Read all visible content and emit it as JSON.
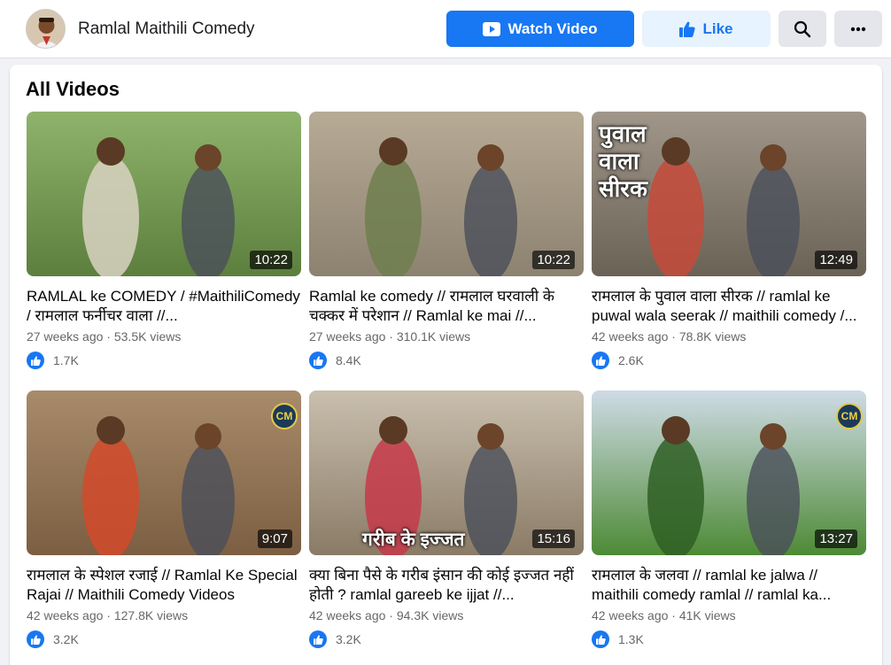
{
  "header": {
    "page_name": "Ramlal Maithili Comedy",
    "watch_label": "Watch Video",
    "like_label": "Like"
  },
  "section_title": "All Videos",
  "videos": [
    {
      "title": "RAMLAL ke COMEDY / #MaithiliComedy / रामलाल फर्नीचर वाला //...",
      "age": "27 weeks ago",
      "views": "53.5K views",
      "likes": "1.7K",
      "duration": "10:22",
      "overlay": "",
      "caption": "",
      "badge": "",
      "colors": [
        "#8fb36b",
        "#5c7f3e",
        "#d9d2c2"
      ]
    },
    {
      "title": "Ramlal ke comedy // रामलाल घरवाली के चक्कर में परेशान // Ramlal ke mai //...",
      "age": "27 weeks ago",
      "views": "310.1K views",
      "likes": "8.4K",
      "duration": "10:22",
      "overlay": "",
      "caption": "",
      "badge": "",
      "colors": [
        "#b7ab96",
        "#8d8270",
        "#6e7f4e"
      ]
    },
    {
      "title": "रामलाल के पुवाल वाला सीरक // ramlal ke puwal wala seerak // maithili comedy /...",
      "age": "42 weeks ago",
      "views": "78.8K views",
      "likes": "2.6K",
      "duration": "12:49",
      "overlay": "पुवाल\nवाला\nसीरक",
      "caption": "",
      "badge": "",
      "colors": [
        "#a0968a",
        "#6b6256",
        "#c64a3a"
      ]
    },
    {
      "title": "रामलाल के स्पेशल रजाई // Ramlal Ke Special Rajai // Maithili Comedy Videos",
      "age": "42 weeks ago",
      "views": "127.8K views",
      "likes": "3.2K",
      "duration": "9:07",
      "overlay": "",
      "caption": "",
      "badge": "CM",
      "colors": [
        "#a88b6a",
        "#7c5e42",
        "#d24a2a"
      ]
    },
    {
      "title": "क्या बिना पैसे के गरीब इंसान की कोई इज्जत नहीं होती ? ramlal gareeb ke ijjat //...",
      "age": "42 weeks ago",
      "views": "94.3K views",
      "likes": "3.2K",
      "duration": "15:16",
      "overlay": "",
      "caption": "गरीब के इज्जत",
      "badge": "",
      "colors": [
        "#c9bfae",
        "#8a7b66",
        "#c53a4a"
      ]
    },
    {
      "title": "रामलाल के जलवा // ramlal ke jalwa // maithili comedy ramlal // ramlal ka...",
      "age": "42 weeks ago",
      "views": "41K views",
      "likes": "1.3K",
      "duration": "13:27",
      "overlay": "",
      "caption": "",
      "badge": "CM",
      "colors": [
        "#cfdbe6",
        "#4d8a35",
        "#2f5f24"
      ]
    }
  ]
}
